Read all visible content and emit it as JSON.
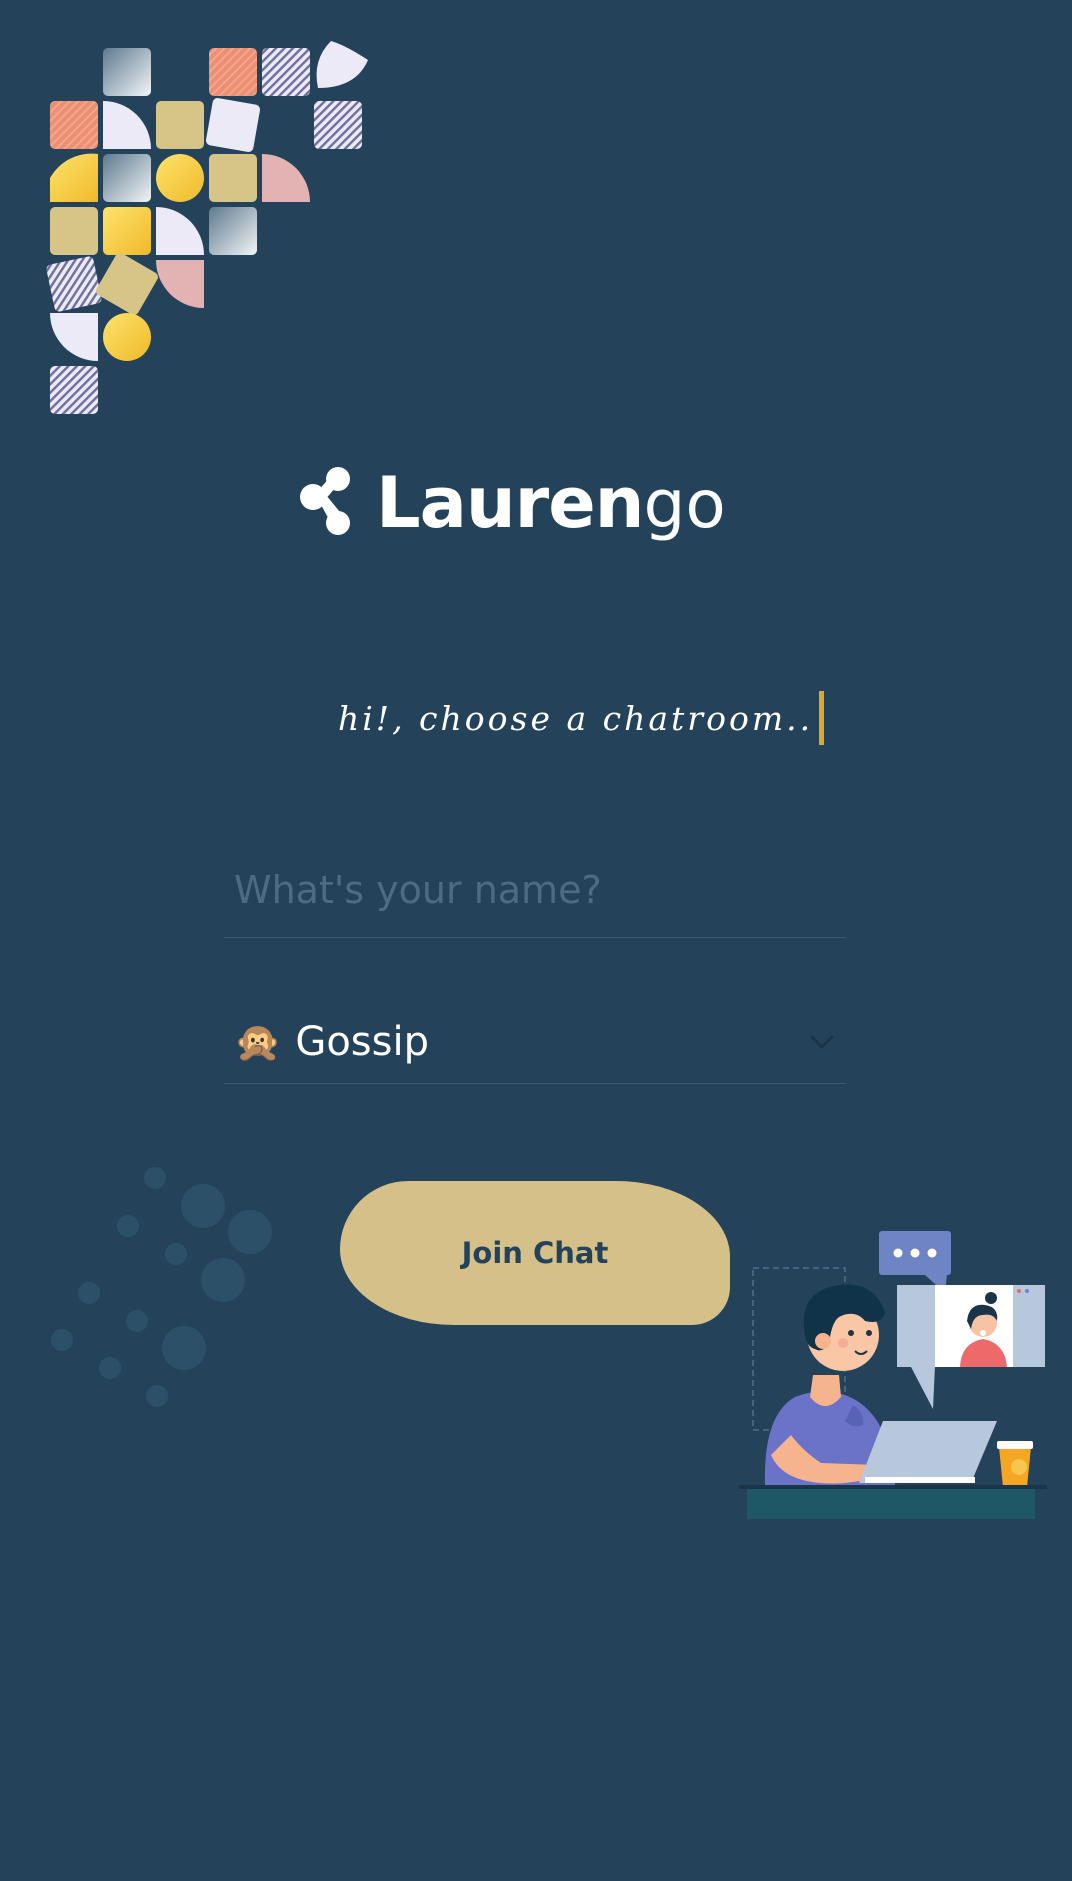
{
  "app": {
    "logo_bold": "Lauren",
    "logo_light": "go"
  },
  "tagline": "hi!, choose a chatroom..",
  "name_input": {
    "value": "",
    "placeholder": "What's your name?"
  },
  "room_select": {
    "emoji": "🙊",
    "selected": "Gossip"
  },
  "join_button": {
    "label": "Join Chat"
  },
  "colors": {
    "background": "#24435a",
    "accent": "#d4c088",
    "caret": "#e0a81e"
  },
  "icons": [
    "logo-mark-icon",
    "chevron-down-icon"
  ]
}
